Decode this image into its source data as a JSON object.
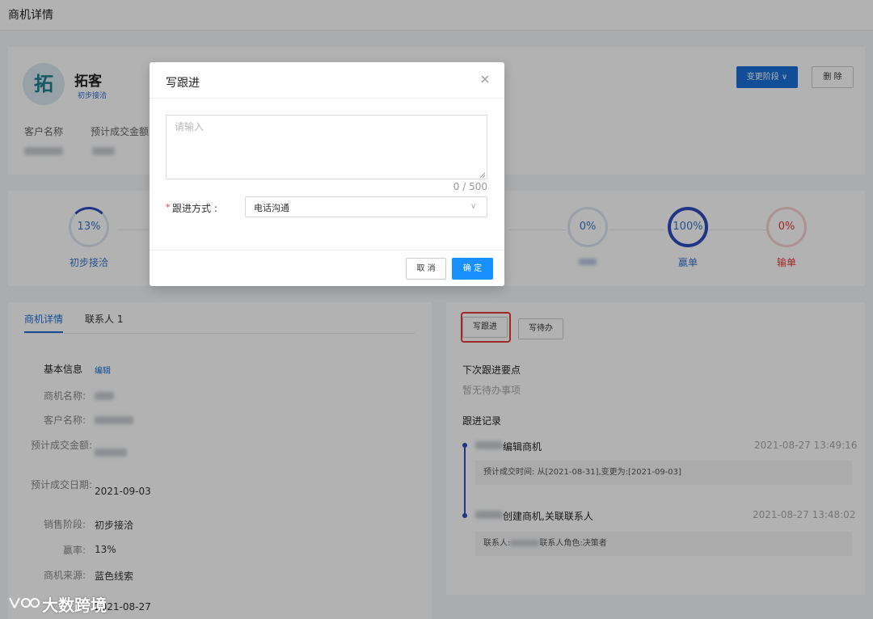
{
  "page": {
    "title": "商机详情"
  },
  "customer": {
    "avatar_char": "拓",
    "name": "拓客",
    "stage_tag": "初步接洽",
    "labels": [
      "客户名称",
      "预计成交金额"
    ]
  },
  "actions": {
    "change_stage": "变更阶段",
    "delete": "删 除"
  },
  "stages": [
    {
      "percent": "13%",
      "label": "初步接洽",
      "progress": 0.13
    },
    {
      "percent": "0%",
      "label": "",
      "progress": 0
    },
    {
      "percent": "100%",
      "label": "赢单",
      "progress": 1
    },
    {
      "percent": "0%",
      "label": "输单",
      "progress": 0
    }
  ],
  "tabs": [
    "商机详情",
    "联系人 1"
  ],
  "basic_info": {
    "title": "基本信息",
    "edit": "编辑",
    "fields": [
      {
        "label": "商机名称:",
        "value": ""
      },
      {
        "label": "客户名称:",
        "value": ""
      },
      {
        "label": "预计成交金额:",
        "value": ""
      },
      {
        "label": "预计成交日期:",
        "value": "2021-09-03"
      },
      {
        "label": "销售阶段:",
        "value": "初步接洽"
      },
      {
        "label": "赢率:",
        "value": "13%"
      },
      {
        "label": "商机来源:",
        "value": "蓝色线索"
      },
      {
        "label": "",
        "value": "2021-08-27"
      }
    ]
  },
  "followup_panel": {
    "write_followup": "写跟进",
    "write_todo": "写待办",
    "next_title": "下次跟进要点",
    "next_empty": "暂无待办事项",
    "records_title": "跟进记录",
    "records": [
      {
        "action": "编辑商机",
        "time": "2021-08-27 13:49:16",
        "detail": "预计成交时间: 从[2021-08-31],变更为:[2021-09-03]"
      },
      {
        "action": "创建商机,关联联系人",
        "time": "2021-08-27 13:48:02",
        "detail_prefix": "联系人:",
        "detail_suffix": "联系人角色:决策者"
      }
    ]
  },
  "modal": {
    "title": "写跟进",
    "close": "×",
    "placeholder": "请输入",
    "char_count": "0 / 500",
    "required": "*",
    "method_label": "跟进方式 :",
    "method_value": "电话沟通",
    "cancel": "取 消",
    "confirm": "确 定"
  },
  "watermark": "大数跨境",
  "colors": {
    "primary": "#1b6fd8",
    "confirm": "#1890ff",
    "danger": "#e53935",
    "timeline": "#2f4bbd"
  }
}
